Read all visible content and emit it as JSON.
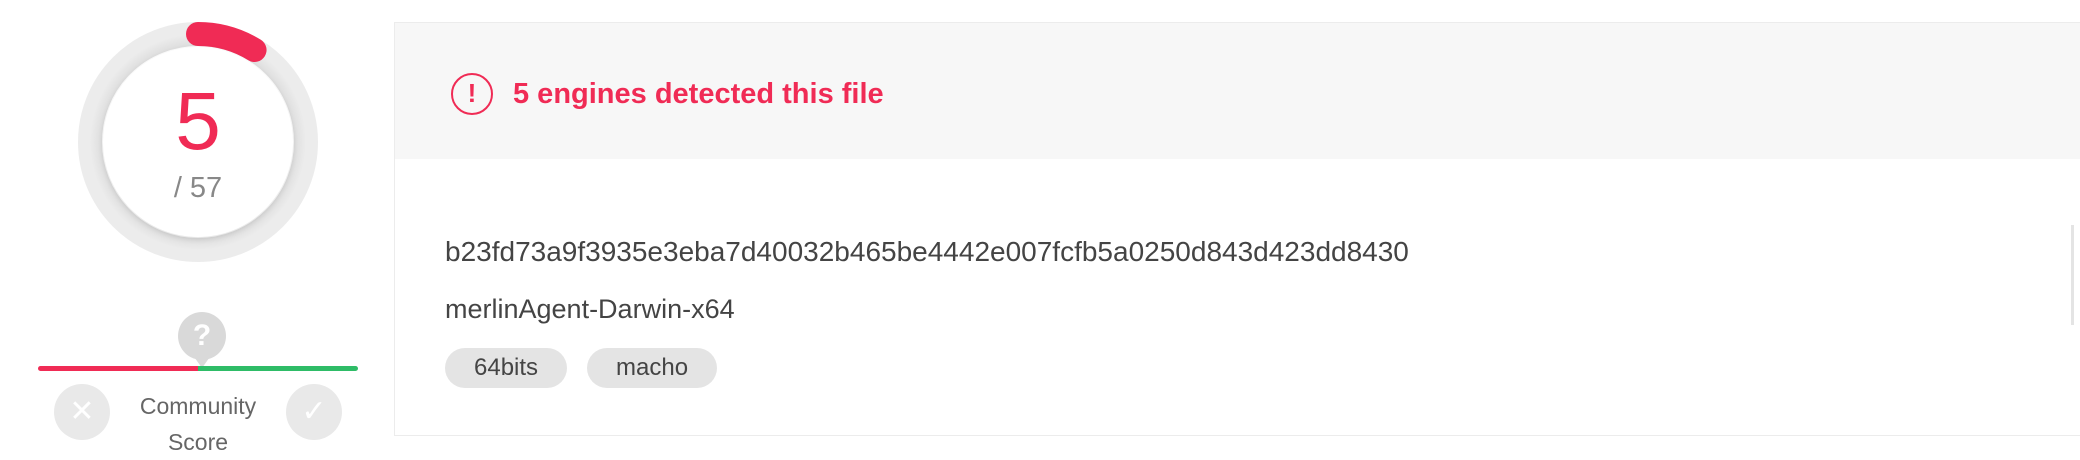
{
  "detection": {
    "positives": "5",
    "total": "/ 57",
    "ratio": 0.0877,
    "colors": {
      "malicious": "#f02b55",
      "ring_track": "#dcdcdc"
    }
  },
  "community": {
    "score_marker": "?",
    "label": "Community Score",
    "harmful_icon": "close-icon",
    "harmless_icon": "check-icon",
    "score_position": 0.5,
    "colors": {
      "negative": "#f02b55",
      "positive": "#2ebc67"
    }
  },
  "alert": {
    "icon": "exclamation-circle-icon",
    "text": "5 engines detected this file"
  },
  "file": {
    "hash": "b23fd73a9f3935e3eba7d40032b465be4442e007fcfb5a0250d843d423dd8430",
    "name": "merlinAgent-Darwin-x64",
    "tags": [
      "64bits",
      "macho"
    ]
  }
}
